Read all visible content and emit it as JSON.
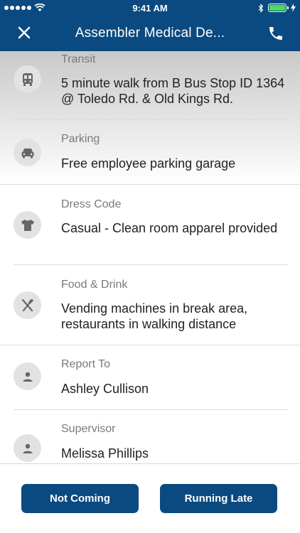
{
  "status_bar": {
    "time": "9:41 AM"
  },
  "nav": {
    "title": "Assembler Medical De..."
  },
  "details": [
    {
      "label": "Transit",
      "value": "5 minute walk from B Bus Stop ID 1364 @ Toledo Rd. & Old Kings Rd.",
      "icon": "bus-icon"
    },
    {
      "label": "Parking",
      "value": "Free employee parking garage",
      "icon": "car-icon"
    },
    {
      "label": "Dress Code",
      "value": "Casual - Clean room apparel provided",
      "icon": "shirt-icon"
    },
    {
      "label": "Food & Drink",
      "value": "Vending machines in break area, restaurants in walking distance",
      "icon": "fork-knife-icon"
    },
    {
      "label": "Report To",
      "value": "Ashley Cullison",
      "icon": "person-icon"
    },
    {
      "label": "Supervisor",
      "value": "Melissa Phillips",
      "icon": "person-icon"
    }
  ],
  "footer": {
    "not_coming_label": "Not Coming",
    "running_late_label": "Running Late"
  },
  "colors": {
    "primary": "#0b4a80",
    "battery": "#4cd964",
    "icon_bg": "#e2e2e2"
  }
}
